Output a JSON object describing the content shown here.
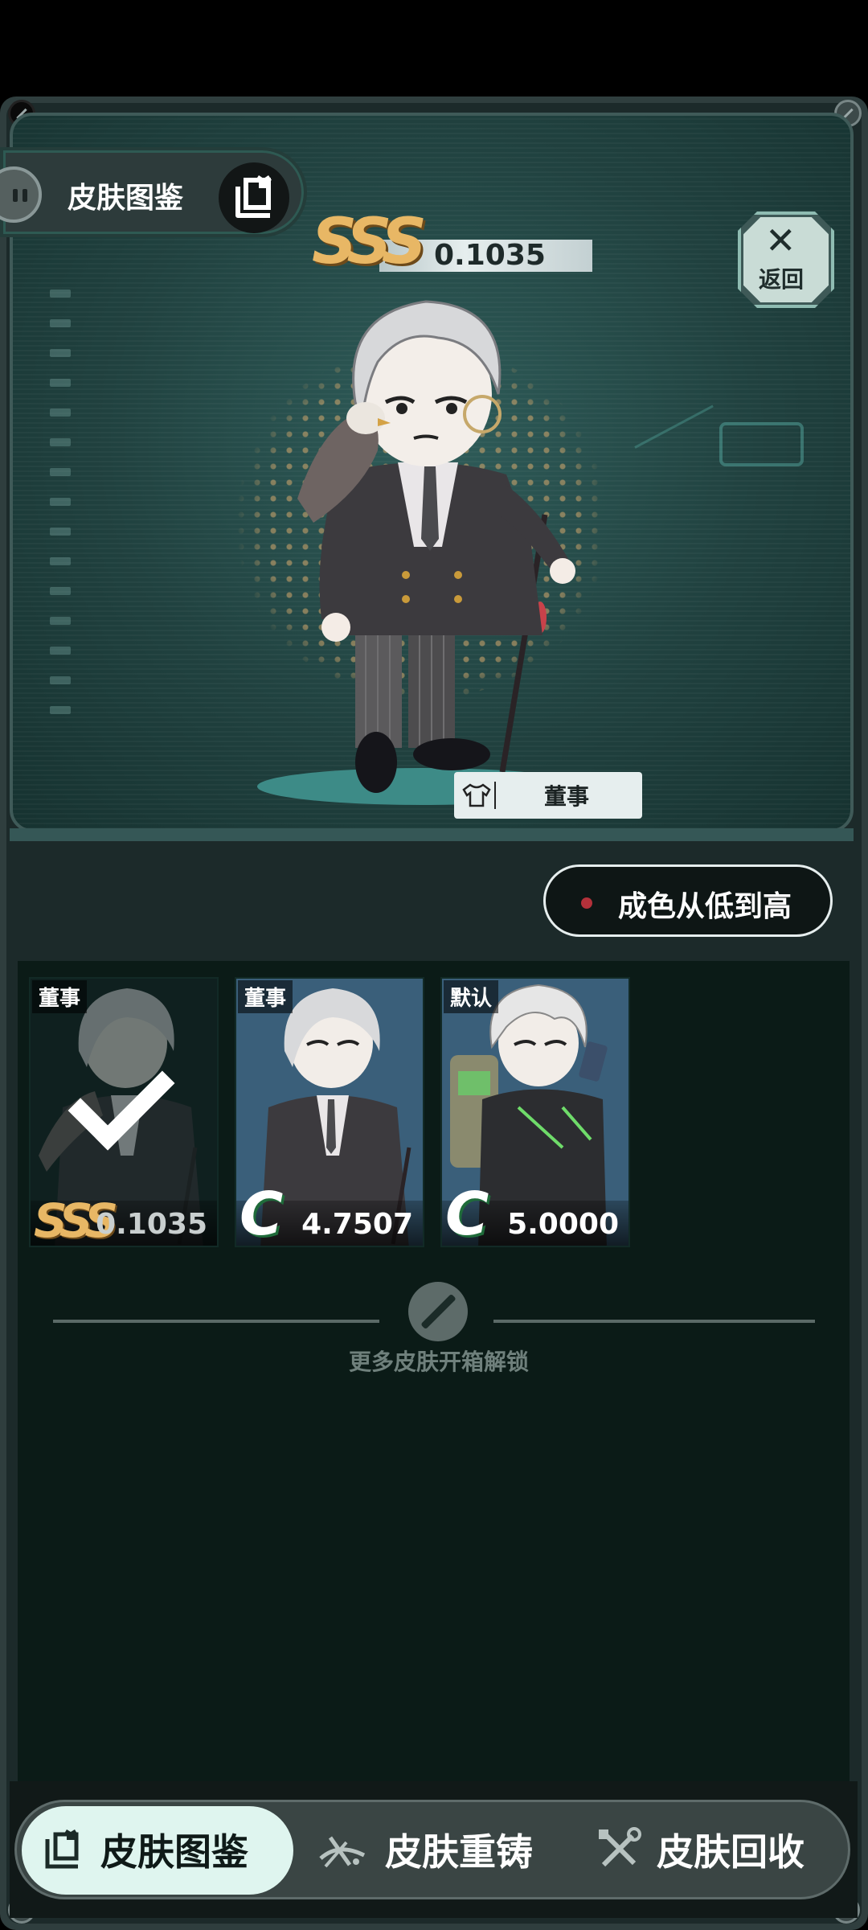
{
  "header": {
    "title": "皮肤图鉴",
    "back_label": "返回",
    "back_glyph": "✕"
  },
  "featured": {
    "rarity_grade": "SSS",
    "rarity_value": "0.1035",
    "skin_name": "董事",
    "rarity_color": "#e8b765"
  },
  "sort": {
    "label": "成色从低到高",
    "dot_color": "#b3313a"
  },
  "skins": [
    {
      "name": "董事",
      "grade": "SSS",
      "value": "0.1035",
      "selected": true,
      "grade_color": "#e8b765"
    },
    {
      "name": "董事",
      "grade": "C",
      "value": "4.7507",
      "selected": false,
      "grade_color": "#ffffff"
    },
    {
      "name": "默认",
      "grade": "C",
      "value": "5.0000",
      "selected": false,
      "grade_color": "#ffffff"
    }
  ],
  "unlock_hint": "更多皮肤开箱解锁",
  "nav": {
    "items": [
      {
        "label": "皮肤图鉴",
        "icon": "codex-icon",
        "active": true
      },
      {
        "label": "皮肤重铸",
        "icon": "recast-icon",
        "active": false
      },
      {
        "label": "皮肤回收",
        "icon": "tools-icon",
        "active": false
      }
    ]
  }
}
